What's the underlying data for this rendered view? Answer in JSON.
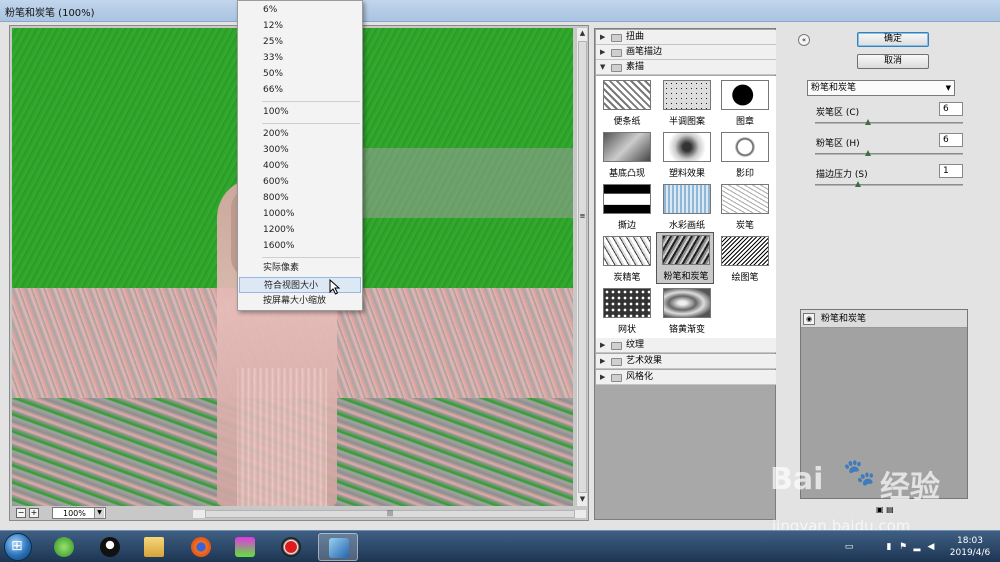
{
  "window": {
    "title": "粉笔和炭笔 (100%)"
  },
  "preview": {
    "zoom": "100%"
  },
  "zoom_menu": {
    "group1": [
      "6%",
      "12%",
      "25%",
      "33%",
      "50%",
      "66%"
    ],
    "group2": [
      "100%"
    ],
    "group3": [
      "200%",
      "300%",
      "400%",
      "600%",
      "800%",
      "1000%",
      "1200%",
      "1600%"
    ],
    "group4": [
      "实际像素",
      "符合视图大小",
      "按屏幕大小缩放"
    ],
    "hovered": "符合视图大小"
  },
  "gallery": {
    "categories_top": [
      "扭曲",
      "画笔描边",
      "素描"
    ],
    "categories_bottom": [
      "纹理",
      "艺术效果",
      "风格化"
    ],
    "expanded": "素描",
    "thumbnails": [
      "便条纸",
      "半调图案",
      "图章",
      "基底凸现",
      "塑料效果",
      "影印",
      "撕边",
      "水彩画纸",
      "炭笔",
      "炭精笔",
      "粉笔和炭笔",
      "绘图笔",
      "网状",
      "铬黄渐变"
    ],
    "selected": "粉笔和炭笔"
  },
  "settings": {
    "ok_label": "确定",
    "cancel_label": "取消",
    "filter_selected": "粉笔和炭笔",
    "params": [
      {
        "label": "炭笔区 (C)",
        "value": "6",
        "max": 20
      },
      {
        "label": "粉笔区 (H)",
        "value": "6",
        "max": 20
      },
      {
        "label": "描边压力 (S)",
        "value": "1",
        "max": 5
      }
    ],
    "layer_name": "粉笔和炭笔"
  },
  "watermark": {
    "brand": "Bai",
    "brand2": "经验",
    "url": "jingyan.baidu.com"
  },
  "taskbar": {
    "time": "18:03",
    "date": "2019/4/6"
  },
  "colors": {
    "preview_green": "#2aa22a",
    "preview_pink": "#e9b4b0",
    "taskbar": "#2a4566",
    "selected_thumb": "#c9c9c9"
  }
}
